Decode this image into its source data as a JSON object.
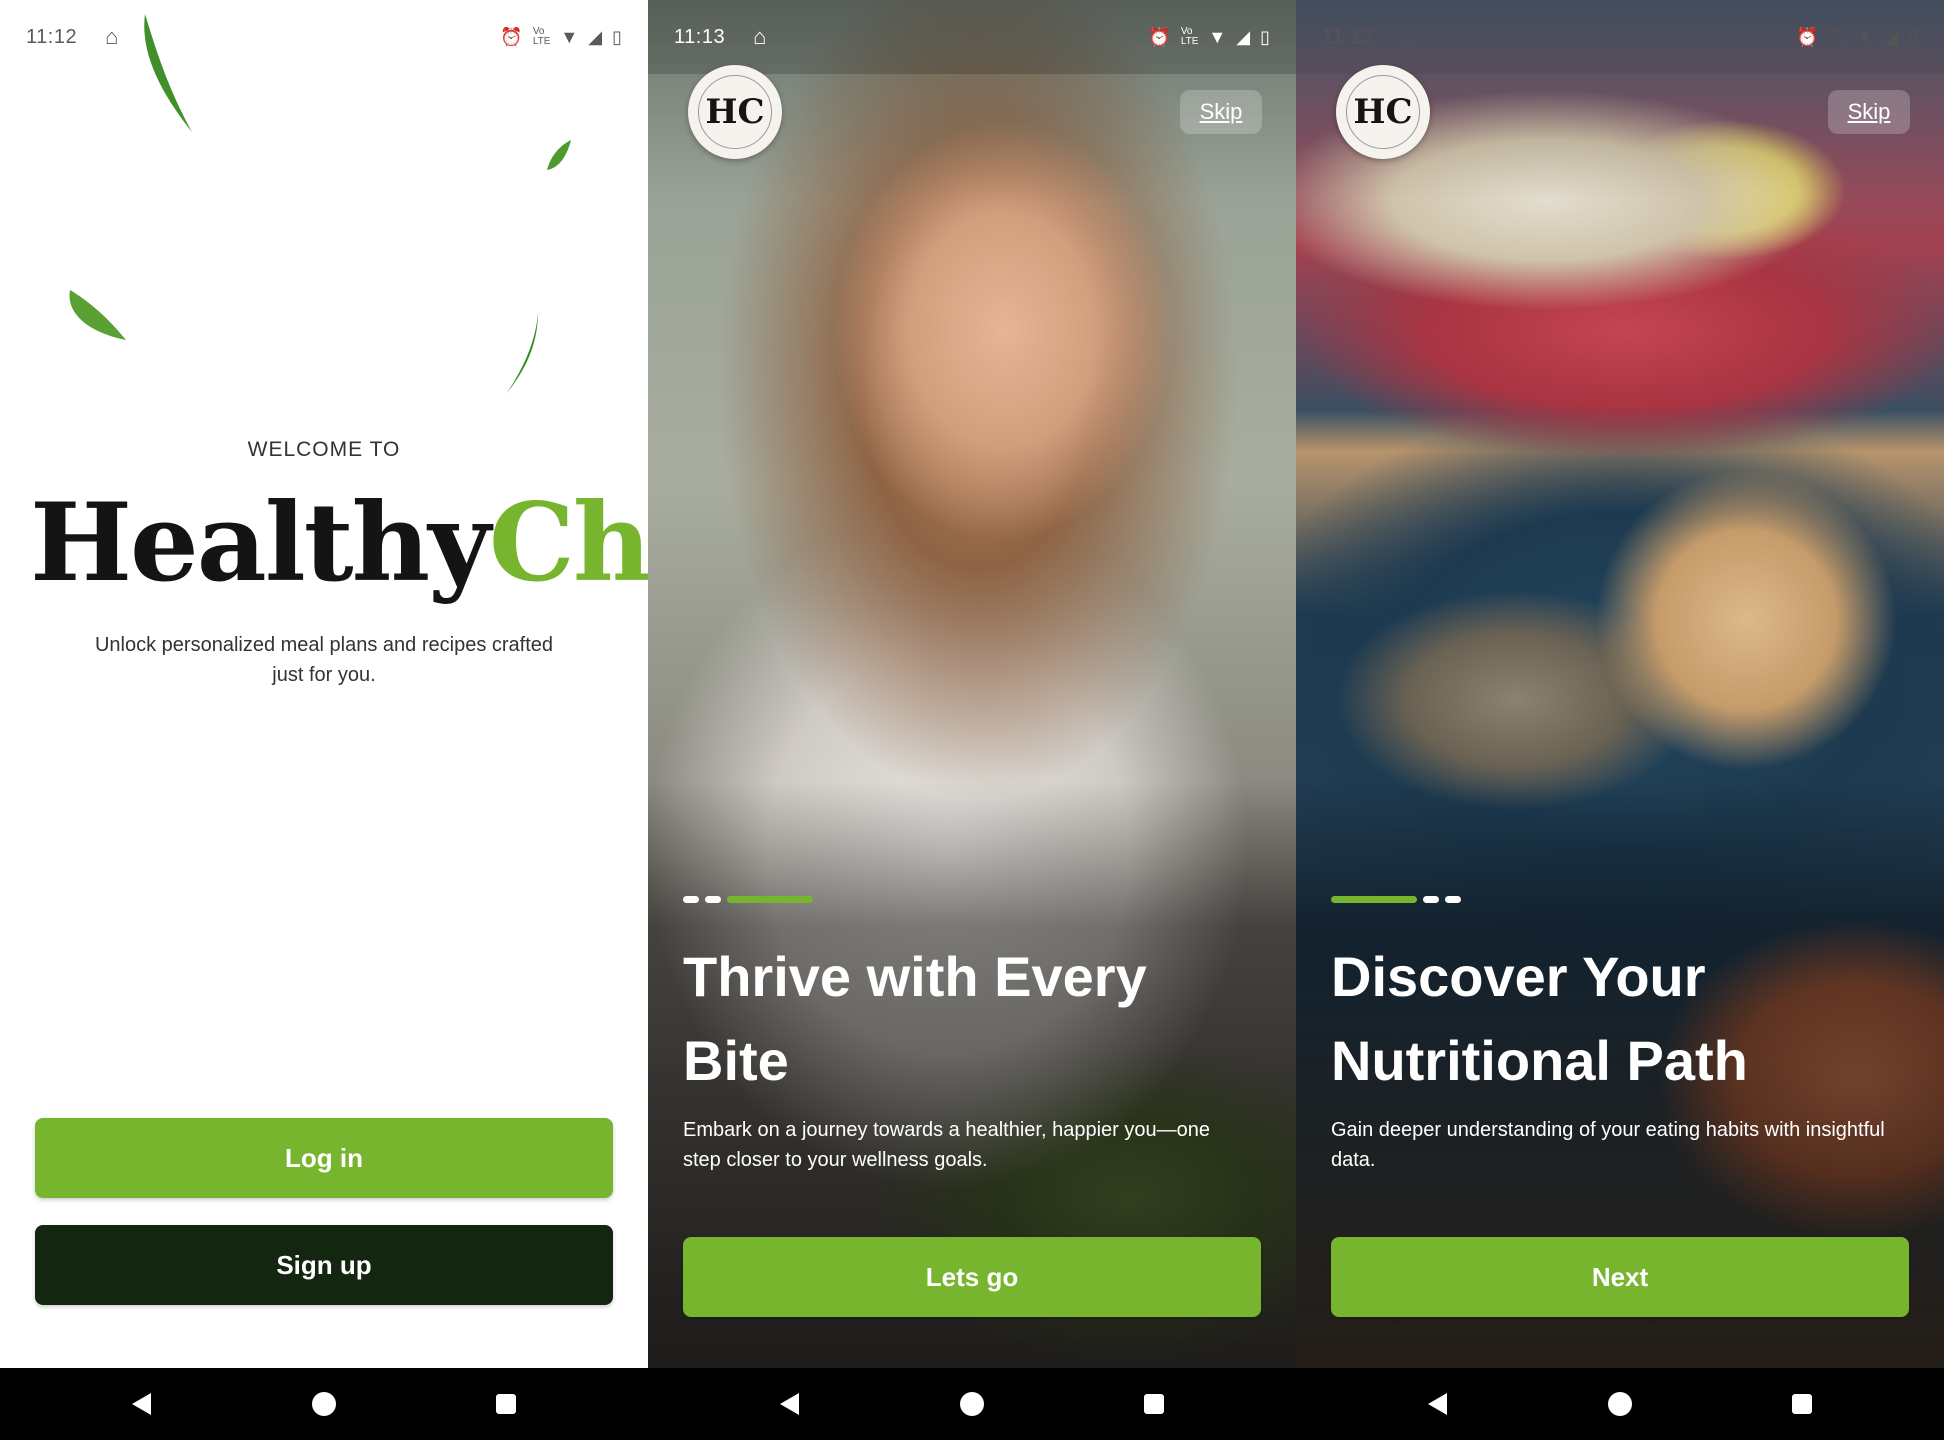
{
  "colors": {
    "accent_green": "#77b52f",
    "dark_green": "#13260f",
    "white": "#ffffff"
  },
  "screen1": {
    "status": {
      "time": "11:12",
      "icons": [
        "home-icon",
        "alarm-icon",
        "volte-icon",
        "wifi-icon",
        "signal-icon",
        "battery-icon"
      ]
    },
    "welcome": "WELCOME TO",
    "logo": {
      "healthy": "Healthy",
      "chef": "Chef"
    },
    "tagline": "Unlock personalized meal plans and recipes crafted just for you.",
    "login_label": "Log in",
    "signup_label": "Sign up"
  },
  "screen2": {
    "status": {
      "time": "11:13"
    },
    "badge_text": "HC",
    "skip_label": "Skip",
    "heading": "Thrive with Every Bite",
    "description": "Embark on a journey towards a healthier, happier you—one step closer to your wellness goals.",
    "button_label": "Lets go",
    "page_indicator": {
      "active_index": 2,
      "count": 3
    }
  },
  "screen3": {
    "status": {
      "time": "11:12"
    },
    "badge_text": "HC",
    "skip_label": "Skip",
    "heading": "Discover Your Nutritional Path",
    "description": "Gain deeper understanding of your eating habits with insightful data.",
    "button_label": "Next",
    "page_indicator": {
      "active_index": 0,
      "count": 3
    }
  },
  "navbar": {
    "icons": [
      "back-icon",
      "home-circle-icon",
      "recents-icon"
    ]
  }
}
